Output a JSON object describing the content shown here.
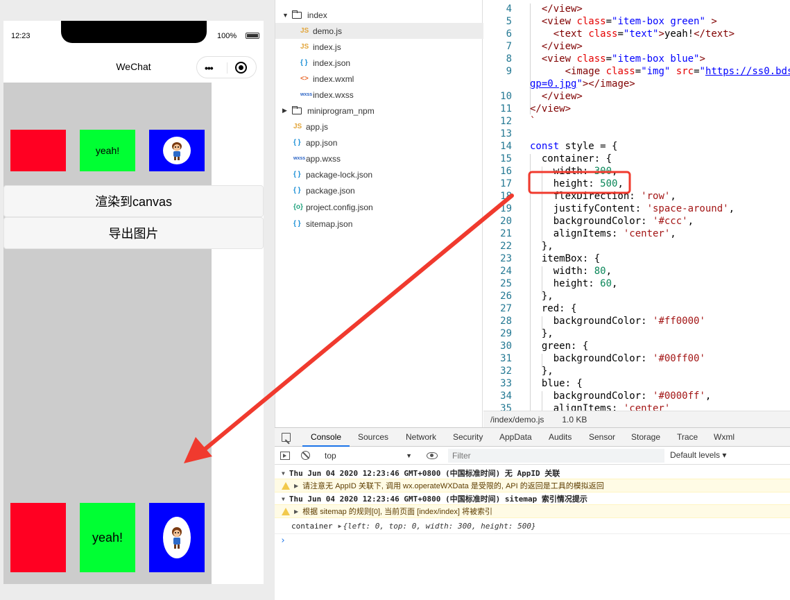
{
  "phone": {
    "time": "12:23",
    "battery": "100%",
    "nav_title": "WeChat",
    "box_green_text": "yeah!",
    "canvas_green_text": "yeah!",
    "render_button": "渲染到canvas",
    "export_button": "导出图片"
  },
  "tree": {
    "items": [
      {
        "label": "index"
      },
      {
        "label": "demo.js",
        "icon": "JS"
      },
      {
        "label": "index.js",
        "icon": "JS"
      },
      {
        "label": "index.json",
        "icon": "{ }"
      },
      {
        "label": "index.wxml",
        "icon": "<>"
      },
      {
        "label": "index.wxss",
        "icon": "wxss"
      },
      {
        "label": "miniprogram_npm"
      },
      {
        "label": "app.js",
        "icon": "JS"
      },
      {
        "label": "app.json",
        "icon": "{ }"
      },
      {
        "label": "app.wxss",
        "icon": "wxss"
      },
      {
        "label": "package-lock.json",
        "icon": "{ }"
      },
      {
        "label": "package.json",
        "icon": "{ }"
      },
      {
        "label": "project.config.json",
        "icon": "{o}"
      },
      {
        "label": "sitemap.json",
        "icon": "{ }"
      }
    ]
  },
  "editor": {
    "line_numbers": [
      "4",
      "5",
      "6",
      "7",
      "8",
      "9",
      "",
      "10",
      "11",
      "12",
      "13",
      "14",
      "15",
      "16",
      "17",
      "18",
      "19",
      "20",
      "21",
      "22",
      "23",
      "24",
      "25",
      "26",
      "27",
      "28",
      "29",
      "30",
      "31",
      "32",
      "33",
      "34",
      "35"
    ],
    "status_path": "/index/demo.js",
    "status_size": "1.0 KB"
  },
  "devtools": {
    "tabs": [
      "Console",
      "Sources",
      "Network",
      "Security",
      "AppData",
      "Audits",
      "Sensor",
      "Storage",
      "Trace",
      "Wxml"
    ],
    "context": "top",
    "filter_placeholder": "Filter",
    "levels": "Default levels ▾",
    "logs": [
      "Thu Jun 04 2020 12:23:46 GMT+0800 (中国标准时间) 无 AppID 关联",
      "请注意无 AppID 关联下, 调用 wx.operateWXData 是受限的, API 的返回是工具的模拟返回",
      "Thu Jun 04 2020 12:23:46 GMT+0800 (中国标准时间) sitemap 索引情况提示",
      "根据 sitemap 的规则[0], 当前页面 [index/index] 将被索引"
    ],
    "container_label": "container",
    "container_obj": "{left: 0, top: 0, width: 300, height: 500}"
  },
  "colors": {
    "red": "#ff0022",
    "green": "#00ff33",
    "blue": "#0000ff",
    "annotation": "#f03a2e",
    "accent": "#1a73e8"
  }
}
